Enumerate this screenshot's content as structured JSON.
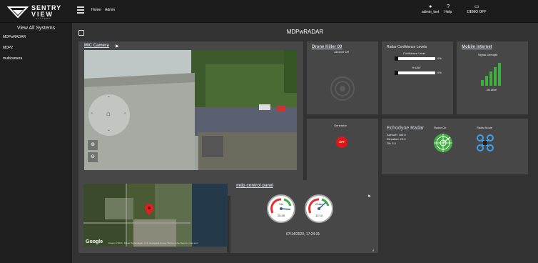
{
  "header": {
    "logo_line1": "SENTRY",
    "logo_line2": "VIEW",
    "logo_line3": "SYSTEMS",
    "nav": [
      {
        "label": "Home"
      },
      {
        "label": "Admin"
      }
    ],
    "user_label": "admin_tset",
    "help_label": "Help",
    "demo_label": "DEMO OFF"
  },
  "sidebar": {
    "title": "View All Systems",
    "items": [
      {
        "label": "MDPwRADAR"
      },
      {
        "label": "MDP2"
      },
      {
        "label": "multicamera"
      }
    ]
  },
  "page": {
    "title": "MDPwRADAR"
  },
  "camera": {
    "title": "MIC Camera"
  },
  "drone_killer": {
    "title": "Drone Killer 00",
    "status": "Jammer Off"
  },
  "radar_conf": {
    "title": "Radar Confidence Levels",
    "items": [
      {
        "label": "Confidence Level",
        "value": "0%"
      },
      {
        "label": "% UAV",
        "value": "0%"
      }
    ]
  },
  "mobile_internet": {
    "title": "Mobile Internet",
    "subtitle": "Signal Strength",
    "value": "-56 dBm"
  },
  "generator": {
    "title": "Generator",
    "button": "OFF"
  },
  "echodyne": {
    "title": "Echodyne Radar",
    "azimuth": "Azimuth: 165.0",
    "elevation": "Elevation: 25.0",
    "tilt": "Tilt: 5.0",
    "radar_on": "Radar On",
    "radar_mode": "Radar Mode"
  },
  "map": {
    "google": "Google",
    "attribution": "Imagery ©2020 , Maxar Technologies, U.S. Geological Survey   Terms of Use   Report a map error"
  },
  "control": {
    "title": "mdp control panel",
    "gauge1": {
      "label": "Vin",
      "value": "25.45"
    },
    "gauge2": {
      "label": "VStart",
      "value": "12.14"
    },
    "timestamp": "07/14/2020, 17:24:31"
  },
  "colors": {
    "accent_green": "#3fae3f",
    "off_red": "#e01515",
    "drone_blue": "#3aa0e8"
  }
}
